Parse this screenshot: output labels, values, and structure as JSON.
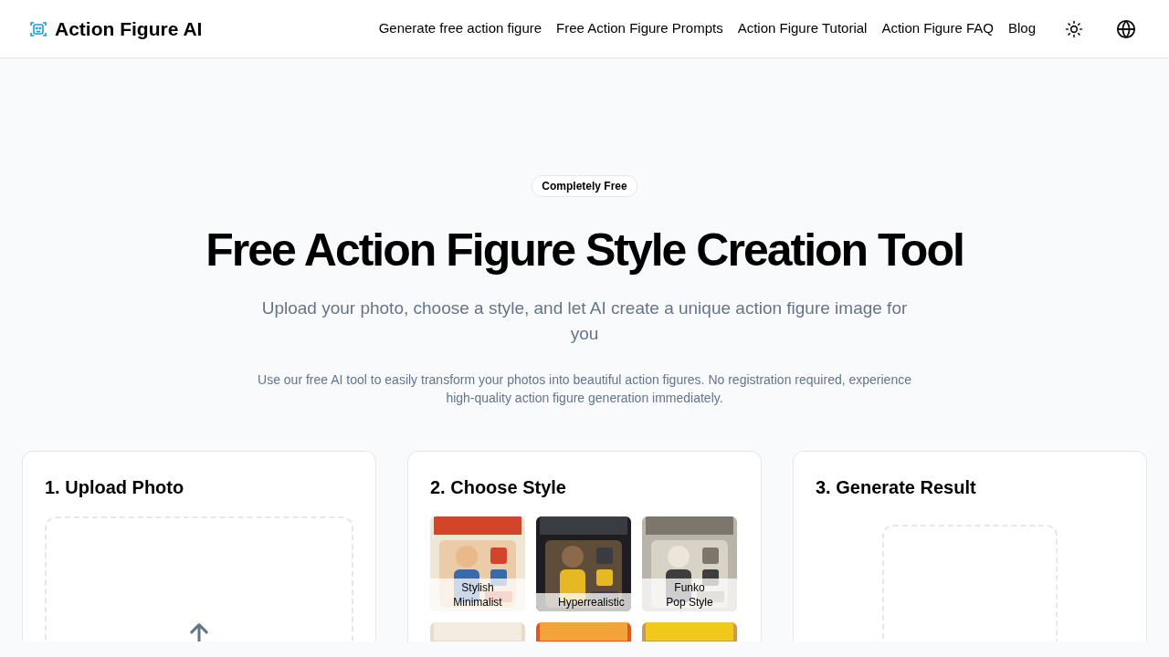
{
  "header": {
    "brand": "Action Figure AI",
    "nav": [
      "Generate free action figure",
      "Free Action Figure Prompts",
      "Action Figure Tutorial",
      "Action Figure FAQ",
      "Blog"
    ]
  },
  "hero": {
    "badge": "Completely Free",
    "title": "Free Action Figure Style Creation Tool",
    "subtitle": "Upload your photo, choose a style, and let AI create a unique action figure image for you",
    "description": "Use our free AI tool to easily transform your photos into beautiful action figures. No registration required, experience high-quality action figure generation immediately."
  },
  "steps": [
    {
      "title": "1. Upload Photo",
      "kind": "upload"
    },
    {
      "title": "2. Choose Style",
      "kind": "styles",
      "styles": [
        {
          "label": "Stylish Minimalist",
          "kind": "picture"
        },
        {
          "label": "Hyperrealistic",
          "kind": "picture"
        },
        {
          "label": "Funko Pop Style",
          "kind": "picture"
        },
        {
          "kind": "picture"
        },
        {
          "kind": "picture"
        },
        {
          "kind": "picture"
        }
      ]
    },
    {
      "title": "3. Generate Result",
      "kind": "result"
    }
  ]
}
